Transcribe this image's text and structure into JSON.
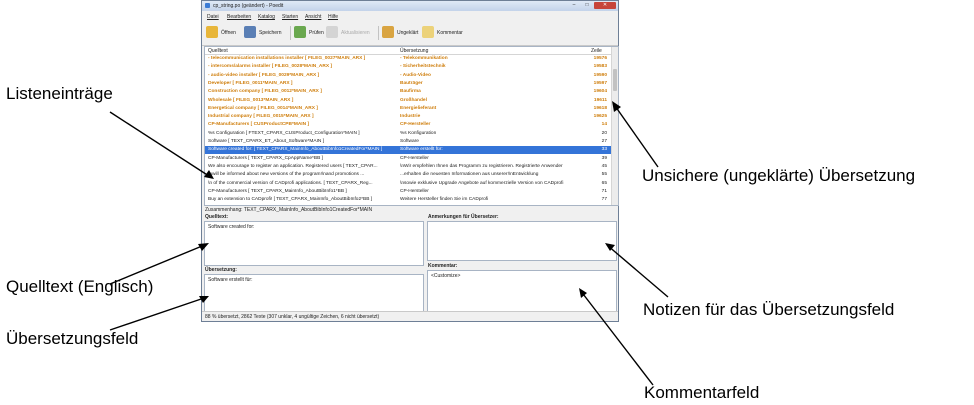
{
  "window": {
    "title": "cp_string.po (geändert) - Poedit",
    "controls": {
      "minimize": "–",
      "maximize": "□",
      "close": "✕"
    }
  },
  "menu": [
    "Datei",
    "Bearbeiten",
    "Katalog",
    "Starten",
    "Ansicht",
    "Hilfe"
  ],
  "toolbar": {
    "open": "Öffnen",
    "save": "Speichern",
    "validate": "Prüfen",
    "update": "Aktualisieren",
    "fuzzy": "Ungeklärt",
    "comment": "Kommentar"
  },
  "list": {
    "headers": {
      "source": "Quelltext",
      "translation": "Übersetzung",
      "line": "Zeile"
    },
    "rows": [
      {
        "source": "- telecommunication installations installer  [ FILEG_0027*MAIN_ARX ]",
        "translation": "- Telekommunikation",
        "line": "19576",
        "state": "fuzzy"
      },
      {
        "source": "- intercoms/alarms installer  [ FILEG_0028*MAIN_ARX ]",
        "translation": "- Sicherheitstechnik",
        "line": "19583",
        "state": "fuzzy"
      },
      {
        "source": "- audio-video installer  [ FILEG_0029*MAIN_ARX ]",
        "translation": "- Audio-Video",
        "line": "19590",
        "state": "fuzzy"
      },
      {
        "source": "Developer  [ FILEG_0011*MAIN_ARX ]",
        "translation": "Bauträger",
        "line": "19597",
        "state": "fuzzy"
      },
      {
        "source": "Construction company  [ FILEG_0012*MAIN_ARX ]",
        "translation": "Baufirma",
        "line": "19604",
        "state": "fuzzy"
      },
      {
        "source": "Wholesale  [ FILEG_0013*MAIN_ARX ]",
        "translation": "Großhandel",
        "line": "19611",
        "state": "fuzzy"
      },
      {
        "source": "Energetical company  [ FILEG_0014*MAIN_ARX ]",
        "translation": "Energielieferant",
        "line": "19618",
        "state": "fuzzy"
      },
      {
        "source": "Industrial company  [ FILEG_0015*MAIN_ARX ]",
        "translation": "Industrie",
        "line": "19625",
        "state": "fuzzy"
      },
      {
        "source": "CP-Manufacturers  [ CUSProductCPB*MAIN ]",
        "translation": "CP-Hersteller",
        "line": "14",
        "state": "fuzzy"
      },
      {
        "source": "%s Configuration  [ FTEXT_CPARX_CUSProduct_Configuration*MAIN ]",
        "translation": "%s Konfiguration",
        "line": "20",
        "state": "normal"
      },
      {
        "source": "Software  [ TEXT_CPARX_ET_About_Software*MAIN ]",
        "translation": "Software",
        "line": "27",
        "state": "normal"
      },
      {
        "source": "Software created for:  [ TEXT_CPARX_MainInfo_AboutBibInfo1CreatedFor*MAIN ]",
        "translation": "Software erstellt für:",
        "line": "33",
        "state": "selected"
      },
      {
        "source": "CP-Manufacturers  [ TEXT_CPARX_CpAppName*BB ]",
        "translation": "CP-Hersteller",
        "line": "39",
        "state": "normal"
      },
      {
        "source": "We also encourage to register an application. Registered users  [ TEXT_CPAR...",
        "translation": "\\nWir empfehlen Ihnen das Programm zu registrieren. Registrierte Anwender",
        "line": "45",
        "state": "normal"
      },
      {
        "source": "\\nwill be informed about new versions of the program!\\nand promotions ...",
        "translation": "...erhalten die neuesten Informationen aus unserer!\\nEntwicklung",
        "line": "55",
        "state": "normal"
      },
      {
        "source": "\\n of the commercial version of CADprofi applications.  [ TEXT_CPARX_Reg...",
        "translation": "\\nsowie exklusive Upgrade Angebote auf kommerzielle Version von CADprofi",
        "line": "65",
        "state": "normal"
      },
      {
        "source": "CP-Manufacturers  [ TEXT_CPARX_MainInfo_AboutBibInfo1*BB ]",
        "translation": "CP-Hersteller",
        "line": "71",
        "state": "normal"
      },
      {
        "source": "Buy an extension to CADprofi!  [ TEXT_CPARX_MainInfo_AboutBibInfo2*BB ]",
        "translation": "Weitere Hersteller finden Sie im CADprofi",
        "line": "77",
        "state": "normal"
      }
    ]
  },
  "context": "Zusammenhang: TEXT_CPARX_MainInfo_AboutBibInfo1CreatedFor*MAIN",
  "source_pane": {
    "label": "Quelltext:",
    "text": "Software created for:"
  },
  "translation_pane": {
    "label": "Übersetzung:",
    "text": "Software erstellt für:"
  },
  "notes_pane": {
    "label": "Anmerkungen für Übersetzer:",
    "text": ""
  },
  "comment_pane": {
    "label": "Kommentar:",
    "text": "<Customize>"
  },
  "status": "88 % übersetzt, 2862 Texte (307 unklar, 4 ungültige Zeichen, 6 nicht übersetzt)",
  "annotations": {
    "list_entries": "Listeneinträge",
    "source_text": "Quelltext (Englisch)",
    "translation_field": "Übersetzungsfeld",
    "fuzzy_translation": "Unsichere (ungeklärte) Übersetzung",
    "notes": "Notizen für das Übersetzungsfeld",
    "comment_field": "Kommentarfeld"
  },
  "colors": {
    "fuzzy": "#cf7e0c",
    "selected": "#3474d8",
    "border": "#a8b4c4"
  }
}
